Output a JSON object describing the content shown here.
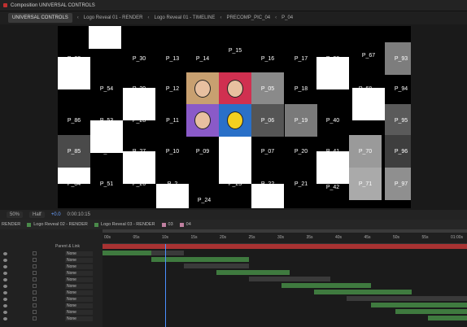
{
  "window": {
    "title": "Composition UNIVERSAL CONTROLS"
  },
  "tabs": [
    {
      "label": "UNIVERSAL CONTROLS"
    },
    {
      "label": "Logo Reveal 01 - RENDER"
    },
    {
      "label": "Logo Reveal 01 - TIMELINE"
    },
    {
      "label": "PRECOMP_PIC_04"
    },
    {
      "label": "P_04"
    }
  ],
  "viewer": {
    "cells": [
      {
        "t": "P_88"
      },
      {
        "t": "P_30"
      },
      {
        "t": "P_13"
      },
      {
        "t": "P_14"
      },
      {
        "t": "P_15"
      },
      {
        "t": "P_16"
      },
      {
        "t": "P_17"
      },
      {
        "t": "P_38"
      },
      {
        "t": "P_67"
      },
      {
        "t": "P_93"
      },
      {
        "t": "P_54"
      },
      {
        "t": "P_29"
      },
      {
        "t": "P_12"
      },
      {
        "t": "P_05"
      },
      {
        "t": "P_18"
      },
      {
        "t": "P_68"
      },
      {
        "t": "P_94"
      },
      {
        "t": "P_86"
      },
      {
        "t": "P_53"
      },
      {
        "t": "P_28"
      },
      {
        "t": "P_11"
      },
      {
        "t": "P_06"
      },
      {
        "t": "P_19"
      },
      {
        "t": "P_40"
      },
      {
        "t": "P_95"
      },
      {
        "t": "P_85"
      },
      {
        "t": "P_52"
      },
      {
        "t": "P_27"
      },
      {
        "t": "P_10"
      },
      {
        "t": "P_09"
      },
      {
        "t": "P_07"
      },
      {
        "t": "P_20"
      },
      {
        "t": "P_41"
      },
      {
        "t": "P_70"
      },
      {
        "t": "P_96"
      },
      {
        "t": "P_84"
      },
      {
        "t": "P_51"
      },
      {
        "t": "P_26"
      },
      {
        "t": "P_2"
      },
      {
        "t": "P_23"
      },
      {
        "t": "P_22"
      },
      {
        "t": "P_21"
      },
      {
        "t": "P_42"
      },
      {
        "t": "P_71"
      },
      {
        "t": "P_97"
      },
      {
        "t": "P_24"
      }
    ]
  },
  "viewer_toolbar": {
    "zoom": "50%",
    "resolution": "Half",
    "exposure": "+0.0",
    "timecode": "0:00:10:15"
  },
  "timeline": {
    "tabs": [
      {
        "label": "RENDER",
        "color": "#4a8a4a"
      },
      {
        "label": "Logo Reveal 02 - RENDER",
        "color": "#4a8a4a"
      },
      {
        "label": "Logo Reveal 03 - RENDER",
        "color": "#4a8a4a"
      },
      {
        "label": "03",
        "color": "#c080a0"
      },
      {
        "label": "04",
        "color": "#c080a0"
      }
    ],
    "ruler": [
      "00s",
      "05s",
      "10s",
      "15s",
      "20s",
      "25s",
      "30s",
      "35s",
      "40s",
      "45s",
      "50s",
      "55s",
      "01:00s"
    ],
    "parent_header": "Parent & Link",
    "parent_value": "None",
    "row_count": 11,
    "colors": {
      "red": "#a83232",
      "green": "#3f7a3f",
      "grey": "#3a3a3a",
      "playhead": "#4a90ff"
    }
  }
}
